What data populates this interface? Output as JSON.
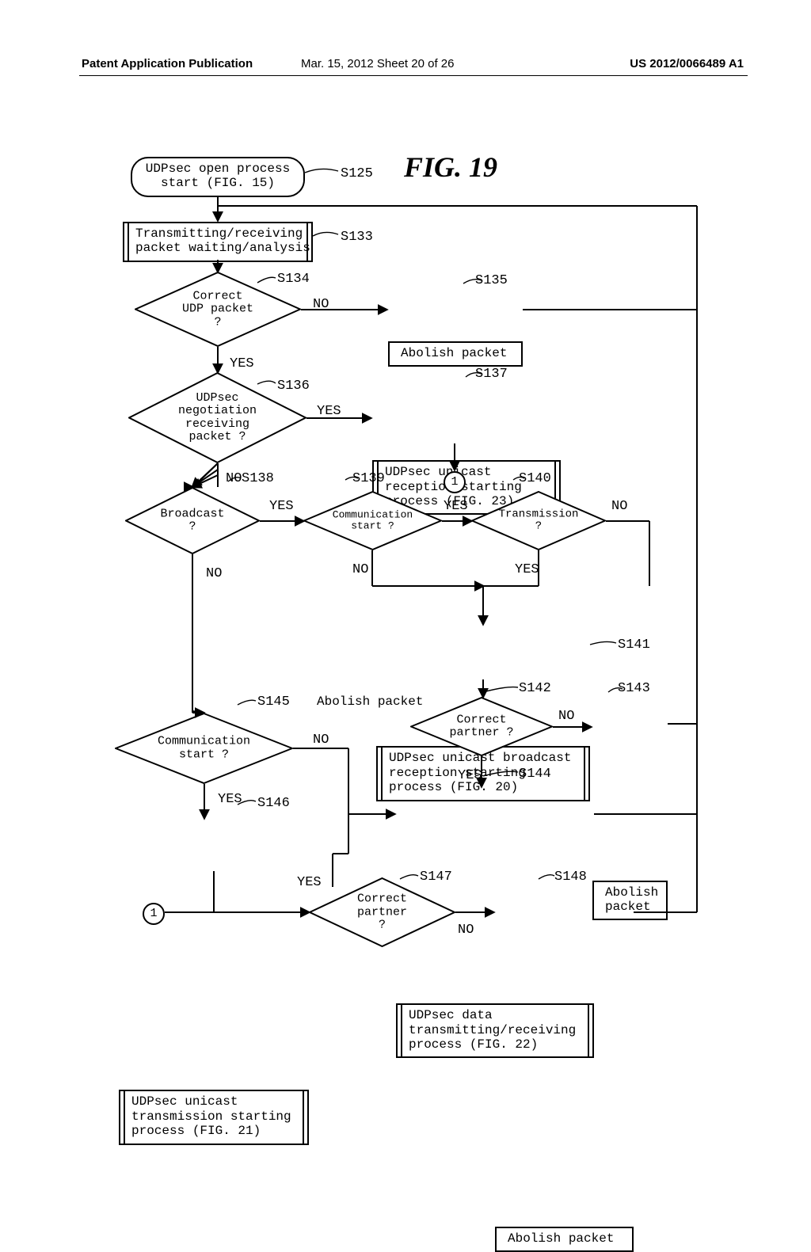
{
  "header": {
    "left": "Patent Application Publication",
    "center": "Mar. 15, 2012  Sheet 20 of 26",
    "right": "US 2012/0066489 A1"
  },
  "figure_label": "FIG. 19",
  "steps": {
    "s125": "S125",
    "s133": "S133",
    "s134": "S134",
    "s135": "S135",
    "s136": "S136",
    "s137": "S137",
    "s138": "S138",
    "s139": "S139",
    "s140": "S140",
    "s141": "S141",
    "s142": "S142",
    "s143": "S143",
    "s144": "S144",
    "s145": "S145",
    "s146": "S146",
    "s147": "S147",
    "s148": "S148"
  },
  "nodes": {
    "start": "UDPsec open process\nstart (FIG. 15)",
    "pkt_wait": "Transmitting/receiving\npacket waiting/analysis",
    "correct_udp": "Correct\nUDP packet\n?",
    "abolish1": "Abolish packet",
    "neg_rx": "UDPsec\nnegotiation\nreceiving\npacket ?",
    "unicast_rx": "UDPsec unicast\nreception starting\nprocess (FIG. 23)",
    "broadcast": "Broadcast\n?",
    "comm_start1": "Communication\nstart ?",
    "transmission": "Transmission\n?",
    "unicast_bcast_rx": "UDPsec unicast broadcast\nreception starting\nprocess (FIG. 20)",
    "correct_partner1": "Correct\npartner ?",
    "abolish2": "Abolish\npacket",
    "data_txrx": "UDPsec data\ntransmitting/receiving\nprocess (FIG. 22)",
    "comm_start2": "Communication\nstart ?",
    "unicast_tx": "UDPsec unicast\ntransmission starting\nprocess (FIG. 21)",
    "correct_partner2": "Correct\npartner\n?",
    "abolish3": "Abolish packet",
    "abolish_free": "Abolish packet"
  },
  "edges": {
    "yes": "YES",
    "no": "NO"
  },
  "conn": {
    "one": "1"
  }
}
